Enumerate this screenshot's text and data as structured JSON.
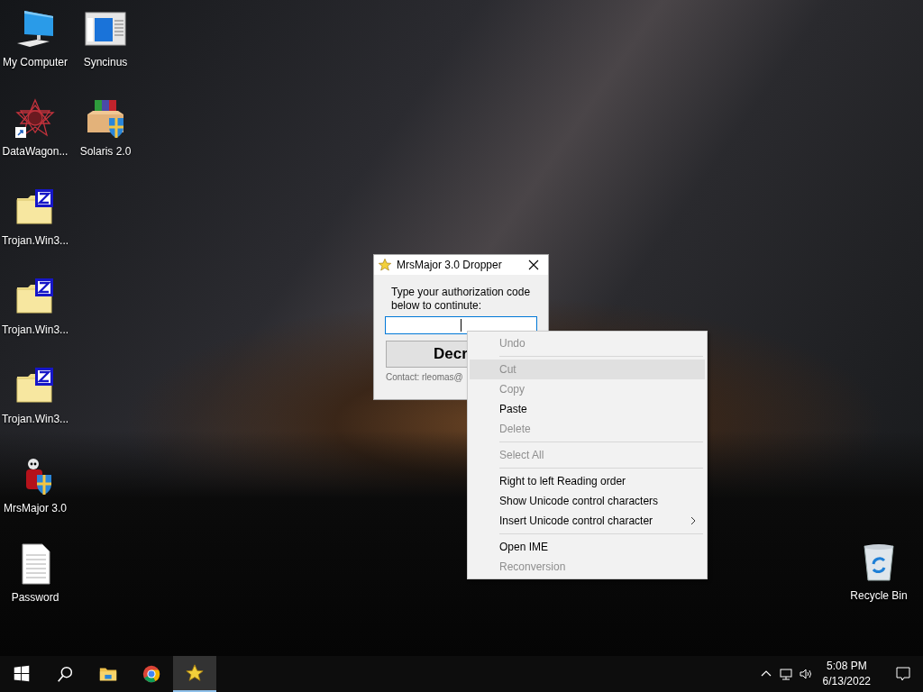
{
  "desktop_icons": [
    {
      "label": "My Computer",
      "kind": "computer"
    },
    {
      "label": "DataWagon...",
      "kind": "star-shortcut"
    },
    {
      "label": "Trojan.Win3...",
      "kind": "zip-folder"
    },
    {
      "label": "Trojan.Win3...",
      "kind": "zip-folder"
    },
    {
      "label": "Trojan.Win3...",
      "kind": "zip-folder"
    },
    {
      "label": "MrsMajor 3.0",
      "kind": "skull-installer"
    },
    {
      "label": "Password",
      "kind": "text-file"
    },
    {
      "label": "Syncinus",
      "kind": "app-window"
    },
    {
      "label": "Solaris 2.0",
      "kind": "installer"
    }
  ],
  "recycle_bin": {
    "label": "Recycle Bin"
  },
  "dialog": {
    "title": "MrsMajor 3.0 Dropper",
    "prompt": "Type your authorization code below to continute:",
    "field": {
      "focused": true
    },
    "button": "Decr",
    "contact": "Contact: rleomas@"
  },
  "context_menu": [
    {
      "kind": "item",
      "label": "Undo",
      "disabled": true,
      "selected": false
    },
    {
      "kind": "separator"
    },
    {
      "kind": "item",
      "label": "Cut",
      "disabled": true,
      "selected": true
    },
    {
      "kind": "item",
      "label": "Copy",
      "disabled": true,
      "selected": false
    },
    {
      "kind": "item",
      "label": "Paste",
      "disabled": false,
      "selected": false
    },
    {
      "kind": "item",
      "label": "Delete",
      "disabled": true,
      "selected": false
    },
    {
      "kind": "separator"
    },
    {
      "kind": "item",
      "label": "Select All",
      "disabled": true,
      "selected": false
    },
    {
      "kind": "separator"
    },
    {
      "kind": "item",
      "label": "Right to left Reading order",
      "disabled": false,
      "selected": false
    },
    {
      "kind": "item",
      "label": "Show Unicode control characters",
      "disabled": false,
      "selected": false
    },
    {
      "kind": "item",
      "label": "Insert Unicode control character",
      "disabled": false,
      "selected": false,
      "submenu": true
    },
    {
      "kind": "separator"
    },
    {
      "kind": "item",
      "label": "Open IME",
      "disabled": false,
      "selected": false
    },
    {
      "kind": "item",
      "label": "Reconversion",
      "disabled": true,
      "selected": false
    }
  ],
  "taskbar": {
    "apps": [
      {
        "kind": "file-explorer",
        "selected": false
      },
      {
        "kind": "browser",
        "selected": false
      },
      {
        "kind": "star-app",
        "selected": true
      }
    ],
    "clock": {
      "time": "5:08 PM",
      "date": "6/13/2022"
    }
  }
}
